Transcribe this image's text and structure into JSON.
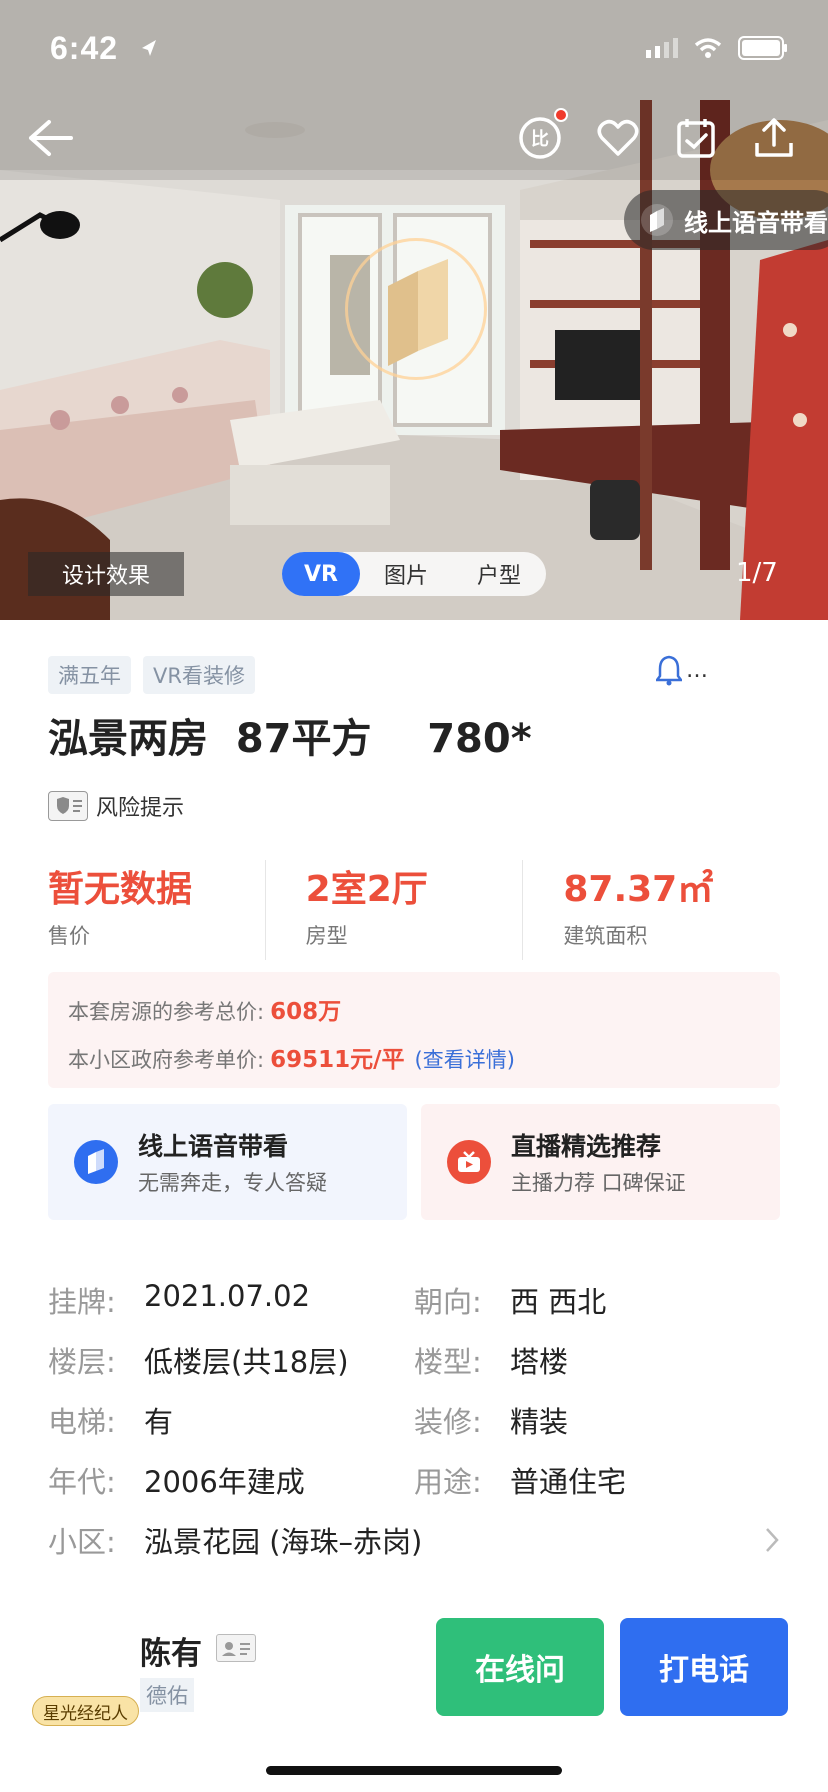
{
  "status": {
    "time": "6:42"
  },
  "hero": {
    "voice_label": "线上语音带看",
    "design_tag": "设计效果",
    "media_tabs": [
      "VR",
      "图片",
      "户型"
    ],
    "counter": "1/7"
  },
  "listing": {
    "tags": [
      "满五年",
      "VR看装修"
    ],
    "title": "泓景两房  87平方    780*",
    "risk_label": "风险提示",
    "stats": [
      {
        "value": "暂无数据",
        "caption": "售价"
      },
      {
        "value": "2室2厅",
        "caption": "房型"
      },
      {
        "value": "87.37㎡",
        "caption": "建筑面积"
      }
    ],
    "reference": {
      "total_label": "本套房源的参考总价:",
      "total_value": "608万",
      "unit_label": "本小区政府参考单价:",
      "unit_value": "69511元/平",
      "detail_link": "(查看详情)"
    },
    "cards": [
      {
        "title": "线上语音带看",
        "subtitle": "无需奔走，专人答疑"
      },
      {
        "title": "直播精选推荐",
        "subtitle": "主播力荐 口碑保证"
      }
    ],
    "details": [
      {
        "label": "挂牌:",
        "value": "2021.07.02"
      },
      {
        "label": "朝向:",
        "value": "西 西北"
      },
      {
        "label": "楼层:",
        "value": "低楼层(共18层)"
      },
      {
        "label": "楼型:",
        "value": "塔楼"
      },
      {
        "label": "电梯:",
        "value": "有"
      },
      {
        "label": "装修:",
        "value": "精装"
      },
      {
        "label": "年代:",
        "value": "2006年建成"
      },
      {
        "label": "用途:",
        "value": "普通住宅"
      }
    ],
    "community": {
      "label": "小区:",
      "value": "泓景花园 (海珠–赤岗)"
    }
  },
  "agent": {
    "name": "陈有",
    "company": "德佑",
    "badge": "星光经纪人",
    "chat_button": "在线问",
    "call_button": "打电话"
  },
  "colors": {
    "accent_red": "#ec4f3b",
    "primary_blue": "#2f6ef0",
    "chat_green": "#2fbf7a"
  }
}
